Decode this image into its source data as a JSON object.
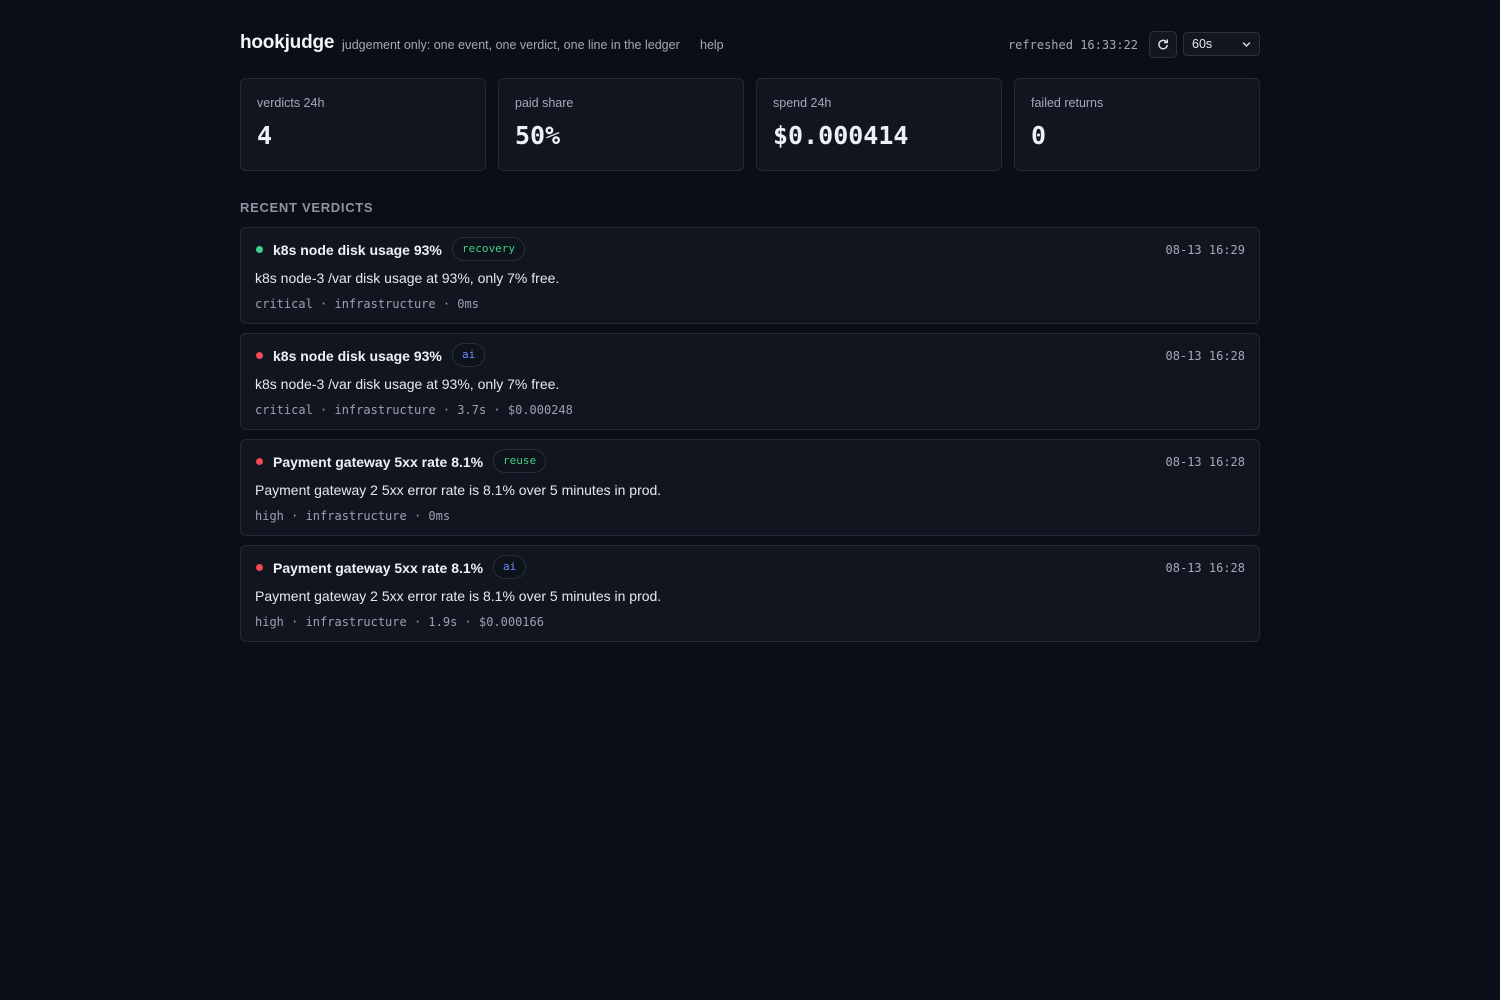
{
  "header": {
    "brand": "hookjudge",
    "tagline": "judgement only: one event, one verdict, one line in the ledger",
    "help": "help",
    "refreshed": "refreshed 16:33:22",
    "interval": "60s"
  },
  "stats": [
    {
      "label": "verdicts 24h",
      "value": "4"
    },
    {
      "label": "paid share",
      "value": "50%"
    },
    {
      "label": "spend 24h",
      "value": "$0.000414"
    },
    {
      "label": "failed returns",
      "value": "0"
    }
  ],
  "section_title": "RECENT VERDICTS",
  "verdicts": [
    {
      "title": "k8s node disk usage 93%",
      "badge": "recovery",
      "badge_color": "#3fd08a",
      "dot_color": "#3fd08a",
      "time": "08-13 16:29",
      "summary": "k8s node-3 /var disk usage at 93%, only 7% free.",
      "meta": "critical · infrastructure · 0ms"
    },
    {
      "title": "k8s node disk usage 93%",
      "badge": "ai",
      "badge_color": "#6f8fff",
      "dot_color": "#ef4a55",
      "time": "08-13 16:28",
      "summary": "k8s node-3 /var disk usage at 93%, only 7% free.",
      "meta": "critical · infrastructure · 3.7s · $0.000248"
    },
    {
      "title": "Payment gateway 5xx rate 8.1%",
      "badge": "reuse",
      "badge_color": "#3fd08a",
      "dot_color": "#ef4a55",
      "time": "08-13 16:28",
      "summary": "Payment gateway 2 5xx error rate is 8.1% over 5 minutes in prod.",
      "meta": "high · infrastructure · 0ms"
    },
    {
      "title": "Payment gateway 5xx rate 8.1%",
      "badge": "ai",
      "badge_color": "#6f8fff",
      "dot_color": "#ef4a55",
      "time": "08-13 16:28",
      "summary": "Payment gateway 2 5xx error rate is 8.1% over 5 minutes in prod.",
      "meta": "high · infrastructure · 1.9s · $0.000166"
    }
  ],
  "icons": {
    "refresh": "refresh-icon",
    "select": "chevron-down-icon"
  }
}
